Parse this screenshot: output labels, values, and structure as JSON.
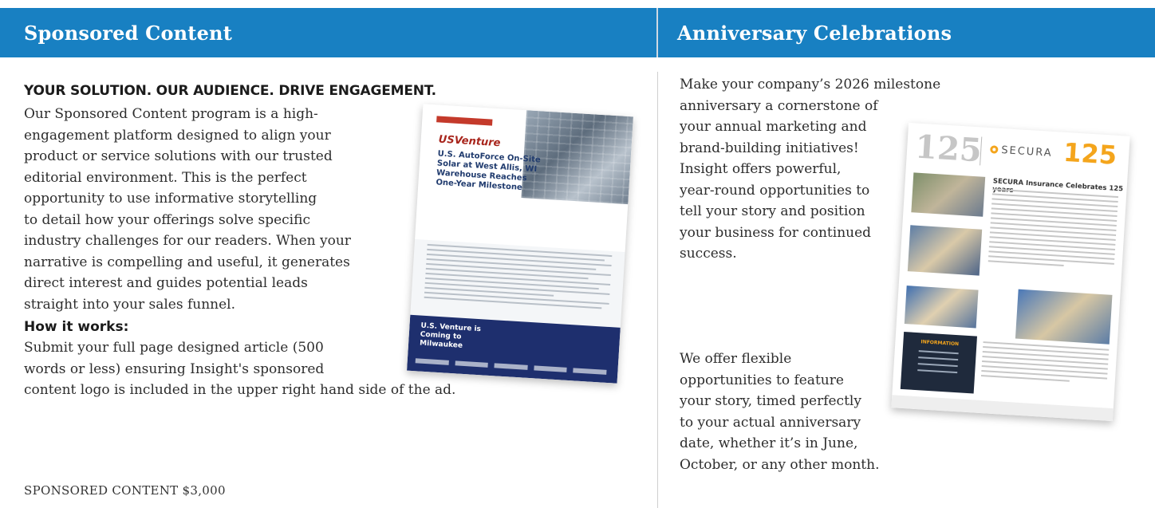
{
  "left": {
    "header": "Sponsored Content",
    "tagline": "YOUR SOLUTION. OUR AUDIENCE. DRIVE ENGAGEMENT.",
    "intro_lines": [
      "Our Sponsored Content program is a high-",
      "engagement platform designed to align your",
      "product or service solutions with our trusted",
      "editorial environment. This is the perfect",
      "opportunity to use informative storytelling",
      "to detail how your offerings solve specific",
      "industry challenges for our readers. When your",
      "narrative is compelling and useful, it generates",
      "direct interest and guides potential leads",
      "straight into your sales funnel."
    ],
    "how_title": "How it works:",
    "how_lines": [
      "Submit your full page designed article (500",
      "words or less) ensuring Insight's sponsored",
      "content logo is included in the upper right hand side of the ad."
    ],
    "price": "SPONSORED CONTENT $3,000"
  },
  "right": {
    "header": "Anniversary Celebrations",
    "para1_lines": [
      "Make your company’s 2026 milestone",
      "anniversary a cornerstone of",
      "your annual marketing and",
      "brand-building initiatives!",
      "Insight offers powerful,",
      "year-round opportunities to",
      "tell your story and position",
      "your business for continued",
      "success."
    ],
    "para2_lines": [
      "We offer flexible",
      "opportunities to feature",
      "your story, timed perfectly",
      "to your actual anniversary",
      "date, whether it’s in June,",
      "October, or any other month."
    ]
  },
  "mock_sponsored": {
    "brand": "USVenture",
    "headline": "U.S. AutoForce On-Site Solar at West Allis, WI Warehouse Reaches One-Year Milestone",
    "footer_title": "U.S. Venture is Coming to Milwaukee"
  },
  "mock_anniversary": {
    "big_number": "125",
    "logo_text": "SECURA",
    "accent_number": "125",
    "title": "SECURA Insurance Celebrates 125 years",
    "info_label": "INFORMATION"
  },
  "colors": {
    "header_bg": "#1880c2",
    "header_text": "#ffffff",
    "secura_orange": "#f4a51c"
  }
}
